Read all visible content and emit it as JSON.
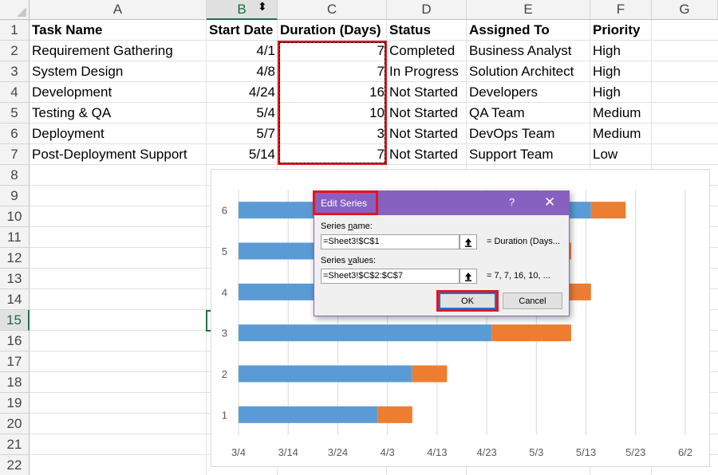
{
  "sheet": {
    "columns": [
      "A",
      "B",
      "C",
      "D",
      "E",
      "F",
      "G"
    ],
    "rows": [
      "1",
      "2",
      "3",
      "4",
      "5",
      "6",
      "7",
      "8",
      "9",
      "10",
      "11",
      "12",
      "13",
      "14",
      "15",
      "16",
      "17",
      "18",
      "19",
      "20",
      "21",
      "22"
    ],
    "headers": {
      "task_name": "Task Name",
      "start_date": "Start Date",
      "duration": "Duration (Days)",
      "status": "Status",
      "assigned_to": "Assigned To",
      "priority": "Priority"
    },
    "tasks": [
      {
        "task": "Requirement Gathering",
        "start": "4/1",
        "duration": "7",
        "status": "Completed",
        "assigned": "Business Analyst",
        "priority": "High"
      },
      {
        "task": "System Design",
        "start": "4/8",
        "duration": "7",
        "status": "In Progress",
        "assigned": "Solution Architect",
        "priority": "High"
      },
      {
        "task": "Development",
        "start": "4/24",
        "duration": "16",
        "status": "Not Started",
        "assigned": "Developers",
        "priority": "High"
      },
      {
        "task": "Testing & QA",
        "start": "5/4",
        "duration": "10",
        "status": "Not Started",
        "assigned": "QA Team",
        "priority": "Medium"
      },
      {
        "task": "Deployment",
        "start": "5/7",
        "duration": "3",
        "status": "Not Started",
        "assigned": "DevOps Team",
        "priority": "Medium"
      },
      {
        "task": "Post-Deployment Support",
        "start": "5/14",
        "duration": "7",
        "status": "Not Started",
        "assigned": "Support Team",
        "priority": "Low"
      }
    ],
    "selected_column": "B",
    "selected_row": "15"
  },
  "chart_data": {
    "type": "bar",
    "orientation": "horizontal",
    "stacked": true,
    "categories": [
      "1",
      "2",
      "3",
      "4",
      "5",
      "6"
    ],
    "x_ticks": [
      "3/4",
      "3/14",
      "3/24",
      "4/3",
      "4/13",
      "4/23",
      "5/3",
      "5/13",
      "5/23",
      "6/2"
    ],
    "xlim": [
      "3/4",
      "6/2"
    ],
    "grid": true,
    "legend": "none",
    "series": [
      {
        "color": "#5b9bd5",
        "values": [
          [
            "3/4",
            "4/1"
          ],
          [
            "3/4",
            "4/8"
          ],
          [
            "3/4",
            "4/24"
          ],
          [
            "3/4",
            "5/4"
          ],
          [
            "3/4",
            "5/7"
          ],
          [
            "3/4",
            "5/14"
          ]
        ]
      },
      {
        "color": "#ed7d31",
        "values": [
          7,
          7,
          16,
          10,
          3,
          7
        ]
      }
    ]
  },
  "dialog": {
    "title": "Edit Series",
    "help": "?",
    "close": "✕",
    "series_name_label_pre": "Series ",
    "series_name_label_ul": "n",
    "series_name_label_post": "ame:",
    "series_name_value": "=Sheet3!$C$1",
    "series_name_preview": "= Duration (Days...",
    "series_values_label_pre": "Series ",
    "series_values_label_ul": "v",
    "series_values_label_post": "alues:",
    "series_values_value": "=Sheet3!$C$2:$C$7",
    "series_values_preview": "= 7, 7, 16, 10, ...",
    "ok_label": "OK",
    "cancel_label": "Cancel"
  },
  "colors": {
    "accent_red": "#e5151f",
    "dialog_purple": "#8661c0",
    "excel_green": "#217346"
  }
}
